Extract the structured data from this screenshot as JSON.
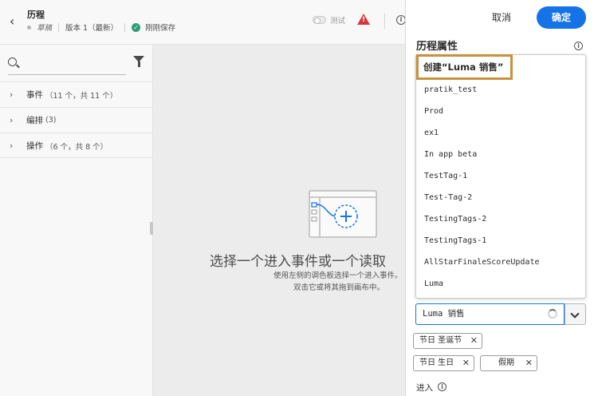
{
  "header": {
    "title": "历程",
    "status": "草稿",
    "version": "版本 1（最新）",
    "saved": "刚刚保存",
    "test_label": "测试"
  },
  "left_panel": {
    "search_placeholder": "",
    "items": [
      {
        "label": "事件",
        "count": "（11 个，共 11 个）"
      },
      {
        "label": "编排",
        "count": "(3)"
      },
      {
        "label": "操作",
        "count": "（6 个，共 8 个）"
      }
    ]
  },
  "canvas": {
    "empty_title": "选择一个进入事件或一个读取",
    "empty_line1": "使用左侧的调色板选择一个进入事件。",
    "empty_line2": "双击它或将其拖到画布中。"
  },
  "right_panel": {
    "cancel_label": "取消",
    "confirm_label": "确定",
    "section_title": "历程属性",
    "create_option": "创建“Luma 销售”",
    "options": [
      "pratik_test",
      "Prod",
      "ex1",
      "In app beta",
      "TestTag-1",
      "Test-Tag-2",
      "TestingTags-2",
      "TestingTags-1",
      "AllStarFinaleScoreUpdate",
      "Luma"
    ],
    "input_value": "Luma 销售",
    "tags": [
      "节日 圣诞节",
      "节日 生日",
      "假期"
    ],
    "entry_label": "进入"
  },
  "colors": {
    "accent": "#1473e6",
    "highlight_border": "#c8913c",
    "alert": "#d7373f",
    "saved_check": "#2d9d78"
  },
  "icons": [
    "chevron-left-icon",
    "check-circle-icon",
    "alert-icon",
    "info-icon",
    "search-icon",
    "filter-icon",
    "chevron-right-icon",
    "spinner-icon",
    "chevron-down-icon",
    "close-icon"
  ]
}
